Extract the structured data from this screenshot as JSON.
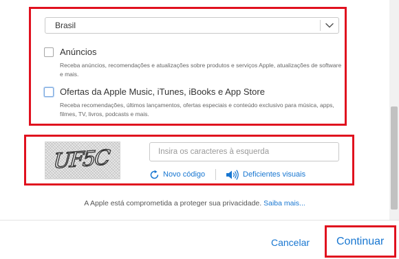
{
  "country_select": {
    "value": "Brasil"
  },
  "consents": [
    {
      "label": "Anúncios",
      "description": "Receba anúncios, recomendações e atualizações sobre produtos e serviços Apple, atualizações de software e mais.",
      "checked": false
    },
    {
      "label": "Ofertas da Apple Music, iTunes, iBooks e App Store",
      "description": "Receba recomendações, últimos lançamentos, ofertas especiais e conteúdo exclusivo para música, apps, filmes, TV, livros, podcasts e mais.",
      "checked": false
    }
  ],
  "captcha": {
    "image_text": "UF5C",
    "input_placeholder": "Insira os caracteres à esquerda",
    "input_value": "",
    "new_code_label": "Novo código",
    "audio_label": "Deficientes visuais"
  },
  "privacy": {
    "text": "A Apple está comprometida a proteger sua privacidade.",
    "link": "Saiba mais..."
  },
  "footer": {
    "cancel_label": "Cancelar",
    "continue_label": "Continuar"
  },
  "colors": {
    "link": "#1776d1",
    "highlight": "#e0101e"
  },
  "icons": {
    "select": "chevron-down-icon",
    "new_code": "refresh-icon",
    "audio": "speaker-icon"
  }
}
